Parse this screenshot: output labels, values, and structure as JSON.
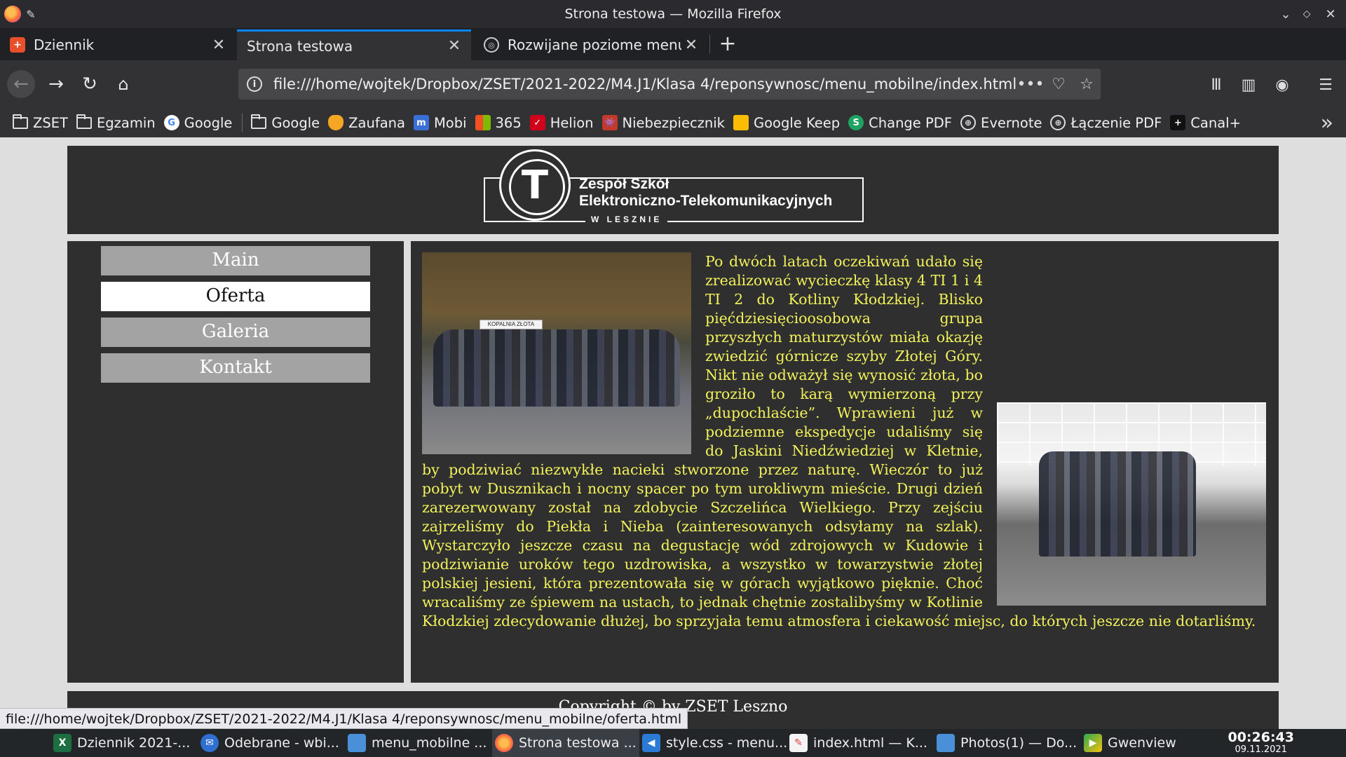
{
  "window": {
    "title": "Strona testowa — Mozilla Firefox"
  },
  "tabs": [
    {
      "label": "Dziennik",
      "icon": "librus-icon",
      "color": "#e8502b"
    },
    {
      "label": "Strona testowa",
      "icon": "page-icon",
      "active": true
    },
    {
      "label": "Rozwijane poziome menu",
      "icon": "fingerprint-icon"
    }
  ],
  "navbar": {
    "url": "file:///home/wojtek/Dropbox/ZSET/2021-2022/M4.J1/Klasa 4/reponsywnosc/menu_mobilne/index.html"
  },
  "bookmarks": [
    {
      "label": "ZSET",
      "icon": "folder-icon"
    },
    {
      "label": "Egzamin",
      "icon": "folder-icon"
    },
    {
      "label": "Google",
      "icon": "google-icon",
      "color": "#4285f4"
    },
    {
      "label": "Google",
      "icon": "folder-icon"
    },
    {
      "label": "Zaufana",
      "icon": "shield-icon",
      "color": "#f5a623"
    },
    {
      "label": "Mobi",
      "icon": "mobi-icon",
      "color": "#3b6fd8"
    },
    {
      "label": "365",
      "icon": "microsoft-icon",
      "color": "#f25022"
    },
    {
      "label": "Helion",
      "icon": "helion-icon",
      "color": "#d0021b"
    },
    {
      "label": "Niebezpiecznik",
      "icon": "invader-icon",
      "color": "#c0392b"
    },
    {
      "label": "Google Keep",
      "icon": "keep-icon",
      "color": "#fbbc04"
    },
    {
      "label": "Change PDF",
      "icon": "s-icon",
      "color": "#1ea362"
    },
    {
      "label": "Evernote",
      "icon": "globe-icon"
    },
    {
      "label": "Łączenie PDF",
      "icon": "globe-icon"
    },
    {
      "label": "Canal+",
      "icon": "plus-icon",
      "color": "#111111"
    }
  ],
  "site": {
    "logo": {
      "line1": "Zespół Szkół",
      "line2": "Elektroniczno-Telekomunikacyjnych",
      "line3": "W LESZNIE",
      "letter": "T"
    },
    "menu": [
      {
        "label": "Main"
      },
      {
        "label": "Oferta",
        "active": true
      },
      {
        "label": "Galeria"
      },
      {
        "label": "Kontakt"
      }
    ],
    "article_text": "Po dwóch latach oczekiwań udało się zrealizować wycieczkę klasy 4 TI 1 i 4 TI 2 do Kotliny Kłodzkiej. Blisko pięćdziesięcioosobowa grupa przyszłych maturzystów miała okazję zwiedzić górnicze szyby Złotej Góry. Nikt nie odważył się wynosić złota, bo groziło to karą wymierzoną przy „dupochlaście”. Wprawieni już w podziemne ekspedycje udaliśmy się do Jaskini Niedźwiedziej w Kletnie, by podziwiać niezwykłe nacieki stworzone przez naturę. Wieczór to już pobyt w Dusznikach i nocny spacer po tym urokliwym mieście. Drugi dzień zarezerwowany został na zdobycie Szczelińca Wielkiego. Przy zejściu zajrzeliśmy do Piekła i Nieba (zainteresowanych odsyłamy na szlak). Wystarczyło jeszcze czasu na degustację wód zdrojowych w Kudowie i podziwianie uroków tego uzdrowiska, a wszystko w towarzystwie złotej polskiej jesieni, która prezentowała się w górach wyjątkowo pięknie. Choć wracaliśmy ze śpiewem na ustach, to jednak chętnie zostalibyśmy w Kotlinie Kłodzkiej zdecydowanie dłużej, bo sprzyjała temu atmosfera i ciekawość miejsc, do których jeszcze nie dotarliśmy.",
    "photo1_sign": "KOPALNIA ZŁOTA",
    "footer": "Copyright © by ZSET Leszno",
    "text_color": "#f2f25a"
  },
  "status_link": "file:///home/wojtek/Dropbox/ZSET/2021-2022/M4.J1/Klasa 4/reponsywnosc/menu_mobilne/oferta.html",
  "taskbar": {
    "items": [
      {
        "label": "Dziennik 2021-...",
        "icon": "excel-icon",
        "color": "#1d6f42"
      },
      {
        "label": "Odebrane - wbi...",
        "icon": "thunderbird-icon",
        "color": "#2f6fd1"
      },
      {
        "label": "menu_mobilne ...",
        "icon": "folder-icon",
        "color": "#4a90d9"
      },
      {
        "label": "Strona testowa ...",
        "icon": "firefox-icon",
        "color": "#ff7139",
        "active": true
      },
      {
        "label": "style.css - menu...",
        "icon": "vscode-icon",
        "color": "#2b7bd6"
      },
      {
        "label": "index.html  — K...",
        "icon": "kate-icon",
        "color": "#e04040"
      },
      {
        "label": "Photos(1) — Do...",
        "icon": "folder-icon",
        "color": "#4a90d9"
      },
      {
        "label": "Gwenview",
        "icon": "gwenview-icon",
        "color": "#2fa84f"
      }
    ],
    "time": "00:26:43",
    "date": "09.11.2021"
  }
}
